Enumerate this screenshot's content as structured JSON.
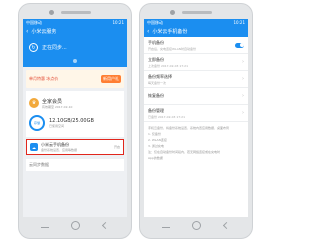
{
  "left_phone": {
    "status_bar": {
      "carrier": "中国移动",
      "time": "10:21"
    },
    "app_bar": {
      "title": "小米云服务"
    },
    "sync": {
      "label": "正在同步..."
    },
    "banner": {
      "promo_text": "单月特惠 冰点价",
      "badge": "新用户礼",
      "app_label": "云服务APP"
    },
    "member": {
      "title": "全家会员",
      "subtitle": "有效期至 2017-02-10"
    },
    "storage": {
      "value": "12.10GB/25.00GB",
      "subtitle": "已使用空间",
      "ring_label": "存储"
    },
    "highlight": {
      "title": "小米云手机备份",
      "subtitle": "备份系统设置、应用等数据",
      "state": "开启"
    },
    "more_label": "云同步数据"
  },
  "right_phone": {
    "status_bar": {
      "carrier": "中国移动",
      "time": "10:21"
    },
    "app_bar": {
      "title": "小米云手机备份"
    },
    "items": [
      {
        "title": "手机备份",
        "subtitle": "开启后，充电连接WLAN时自动备份"
      },
      {
        "title": "立即备份",
        "subtitle": "上次备份 2017-02-03 17:21"
      },
      {
        "title": "备份频率选择",
        "subtitle": "每天备份一次"
      },
      {
        "title": "恢复备份",
        "subtitle": ""
      },
      {
        "title": "备份管理",
        "subtitle": "已备份 2017-02-03 17:21"
      }
    ],
    "notes": [
      "手机云备份，将备份系统设置、系统内置应用数据、桌面布局",
      "1. 仅备份",
      "2. WLAN连接",
      "3. 通过充电",
      "注：仅在自动备份时间段内，若无网络连接或在充电时",
      "App的数据"
    ]
  },
  "colors": {
    "accent": "#1b8ef0",
    "highlight_border": "#e1261c",
    "badge": "#ff7e33"
  }
}
